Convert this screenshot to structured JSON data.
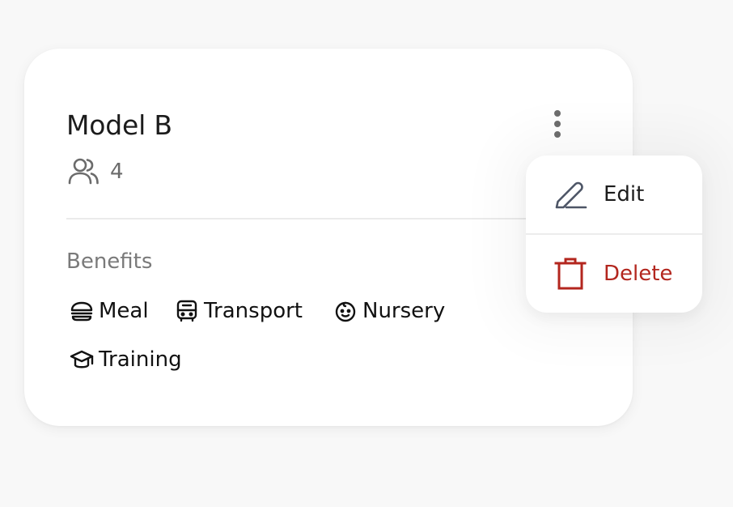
{
  "card": {
    "title": "Model B",
    "member_count": "4",
    "benefits_label": "Benefits",
    "benefits": [
      {
        "label": "Meal",
        "icon": "meal-icon"
      },
      {
        "label": "Transport",
        "icon": "bus-icon"
      },
      {
        "label": "Nursery",
        "icon": "baby-icon"
      },
      {
        "label": "Training",
        "icon": "graduation-cap-icon"
      }
    ]
  },
  "menu": {
    "edit_label": "Edit",
    "delete_label": "Delete"
  },
  "colors": {
    "delete": "#b3261e",
    "edit_icon": "#4d5566",
    "text": "#1c1c1c",
    "muted": "#7a7a7a"
  }
}
